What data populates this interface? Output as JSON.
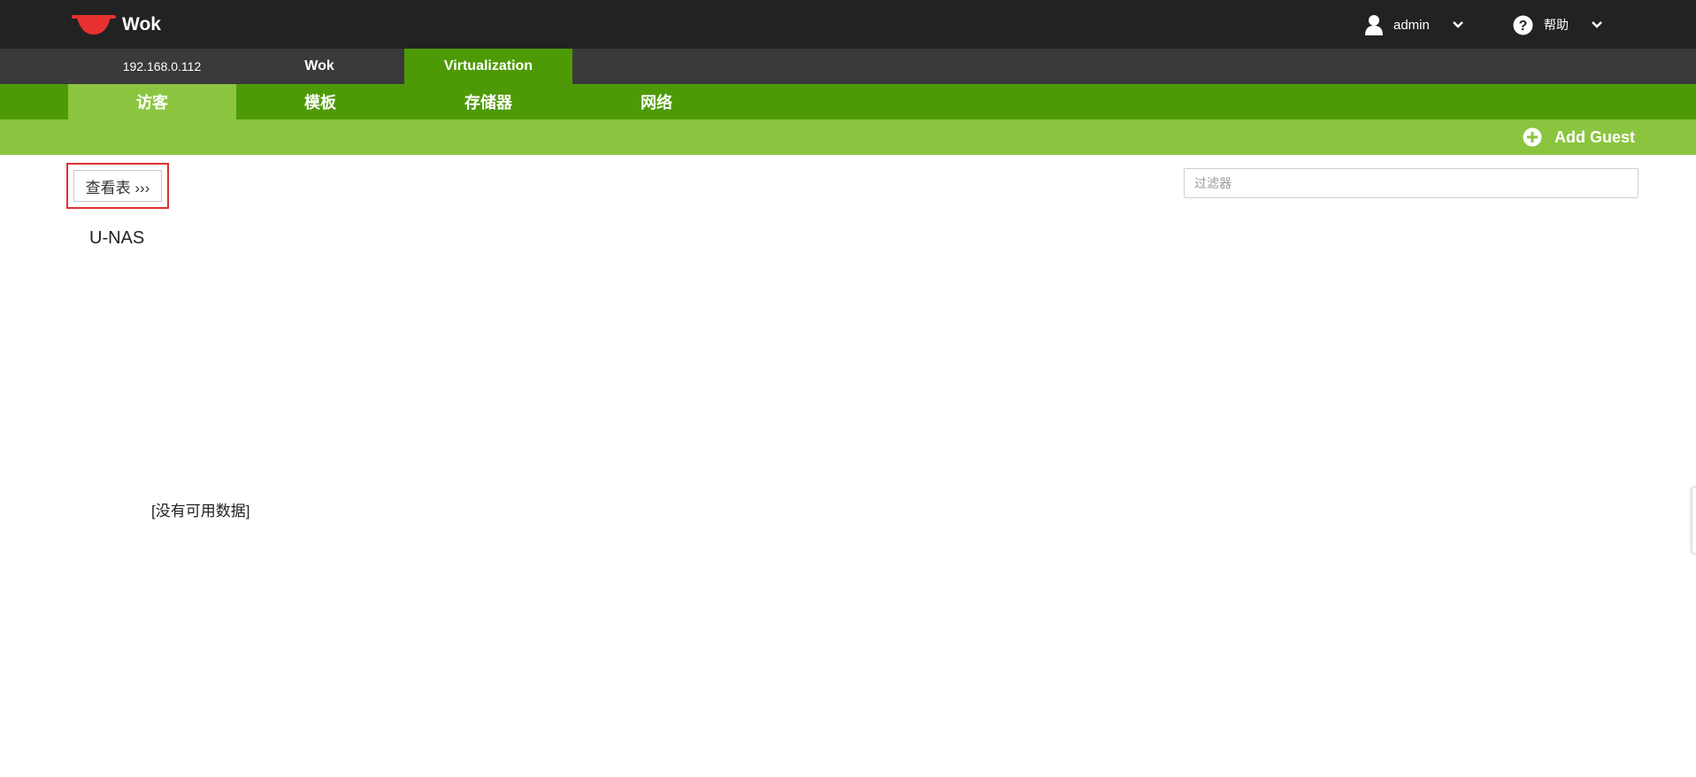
{
  "header": {
    "brand": "Wok",
    "user_menu": {
      "label": "admin",
      "icon": "user-icon"
    },
    "help_menu": {
      "label": "帮助",
      "icon": "help-icon"
    }
  },
  "host_tabs": [
    {
      "label": "192.168.0.112",
      "active": false
    },
    {
      "label": "Wok",
      "active": false
    },
    {
      "label": "Virtualization",
      "active": true
    }
  ],
  "sub_tabs": [
    {
      "label": "访客",
      "active": true
    },
    {
      "label": "模板",
      "active": false
    },
    {
      "label": "存储器",
      "active": false
    },
    {
      "label": "网络",
      "active": false
    }
  ],
  "actions": {
    "add_guest": "Add Guest"
  },
  "toolbar": {
    "view_toggle": "查看表 ›››",
    "filter_placeholder": "过滤器",
    "filter_value": ""
  },
  "content": {
    "guest_name": "U-NAS",
    "no_data": "[没有可用数据]"
  },
  "colors": {
    "topbar": "#222222",
    "hostbar": "#3a3a3c",
    "nav_green": "#4e9a06",
    "light_green": "#8bc53f",
    "highlight_box": "#e03131"
  }
}
